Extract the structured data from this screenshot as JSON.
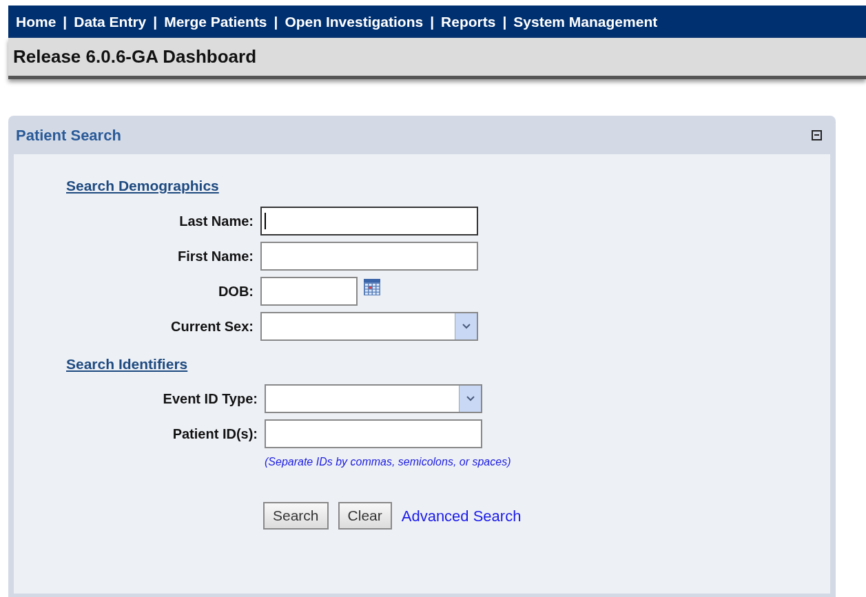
{
  "nav": {
    "separator": "|",
    "items": [
      "Home",
      "Data Entry",
      "Merge Patients",
      "Open Investigations",
      "Reports",
      "System Management"
    ]
  },
  "page_title": "Release 6.0.6-GA Dashboard",
  "panel": {
    "title": "Patient Search",
    "expanded": true,
    "sections": [
      {
        "heading": "Search Demographics",
        "fields": [
          {
            "label": "Last Name:",
            "kind": "text",
            "focused": true
          },
          {
            "label": "First Name:",
            "kind": "text",
            "focused": false
          },
          {
            "label": "DOB:",
            "kind": "date",
            "focused": false
          },
          {
            "label": "Current Sex:",
            "kind": "select",
            "focused": false
          }
        ]
      },
      {
        "heading": "Search Identifiers",
        "fields": [
          {
            "label": "Event ID Type:",
            "kind": "select",
            "focused": false
          },
          {
            "label": "Patient ID(s):",
            "kind": "text",
            "focused": false
          }
        ],
        "hint": "(Separate IDs by commas, semicolons, or spaces)"
      }
    ],
    "buttons": [
      "Search",
      "Clear"
    ],
    "link": "Advanced Search"
  }
}
